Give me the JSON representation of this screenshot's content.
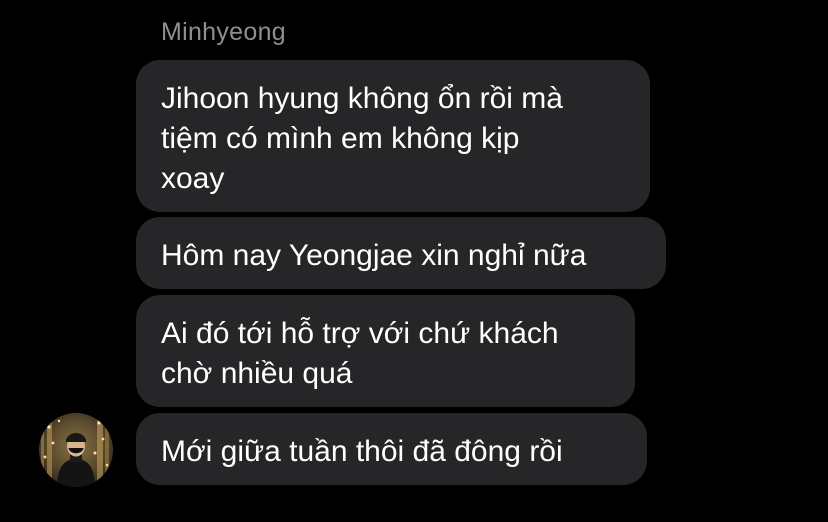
{
  "thread": {
    "sender_name": "Minhyeong",
    "messages": [
      {
        "lines": [
          "Jihoon hyung không ổn rồi mà",
          "tiệm có mình em không kịp",
          "xoay"
        ]
      },
      {
        "lines": [
          "Hôm nay Yeongjae xin nghỉ nữa"
        ]
      },
      {
        "lines": [
          "Ai đó tới hỗ trợ với chứ khách",
          "chờ nhiều quá"
        ]
      },
      {
        "lines": [
          "Mới giữa tuần thôi đã đông rồi"
        ]
      }
    ]
  },
  "colors": {
    "background": "#000000",
    "bubble": "#262628",
    "text": "#ffffff",
    "sender_name": "#8e8e93"
  }
}
